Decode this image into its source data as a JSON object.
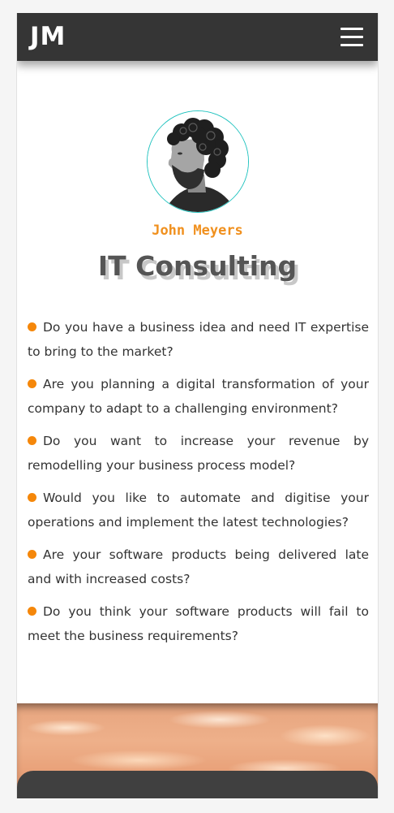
{
  "navbar": {
    "logo": "JM",
    "menu_icon": "hamburger-menu-icon"
  },
  "profile": {
    "name": "John Meyers",
    "headline": "IT Consulting",
    "avatar": "portrait-photo",
    "avatar_border_color": "#22c3bf",
    "name_color": "#f0901e"
  },
  "questions": [
    "Do you have a business idea and need IT expertise to bring to the market?",
    "Are you planning a digital transformation of your company to adapt to a challenging environment?",
    "Do you want to increase your revenue by remodelling your business process model?",
    "Would you like to automate and digitise your operations and implement the latest technologies?",
    "Are your software products being delivered late and with increased costs?",
    "Do you think your software products will fail to meet the business requirements?"
  ],
  "colors": {
    "navbar": "#353535",
    "bullet": "#f5870a",
    "text": "#333333"
  }
}
